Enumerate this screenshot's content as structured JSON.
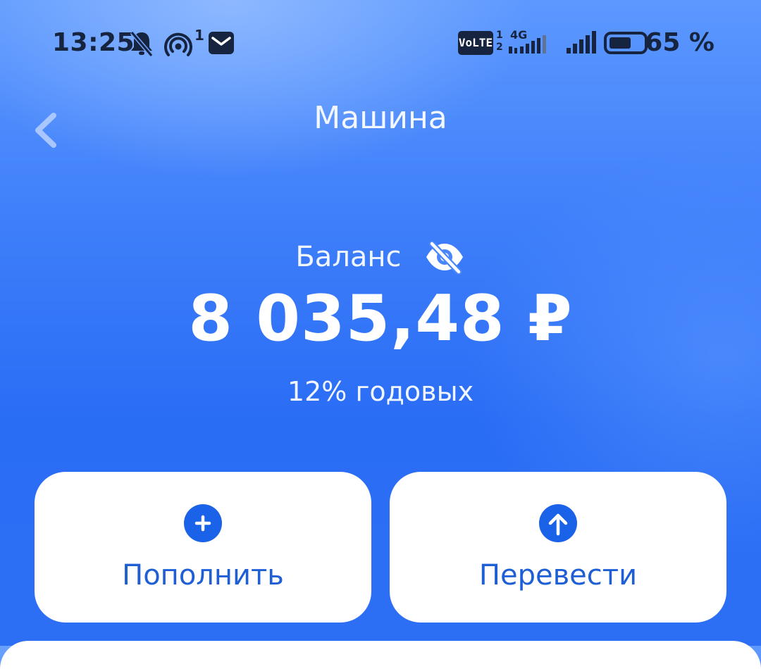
{
  "status_bar": {
    "time": "13:25",
    "notification_count": "1",
    "volte": "VoLTE",
    "sim_1": "1",
    "sim_2": "2",
    "network": "4G",
    "battery": "65 %",
    "battery_level_fraction": 0.65,
    "icons": [
      "bell-off-icon",
      "hotspot-icon",
      "mail-icon",
      "signal-icon",
      "battery-icon"
    ]
  },
  "header": {
    "title": "Машина",
    "back_icon": "chevron-left-icon"
  },
  "balance": {
    "label": "Баланс",
    "amount": "8 035,48 ₽",
    "rate": "12% годовых",
    "visibility_icon": "eye-off-icon"
  },
  "actions": [
    {
      "label": "Пополнить",
      "icon": "plus-circle-icon"
    },
    {
      "label": "Перевести",
      "icon": "arrow-up-circle-icon"
    }
  ],
  "colors": {
    "accent": "#1f5fd6",
    "background": "#3e7efa",
    "status_text": "#16243f",
    "card": "#ffffff"
  }
}
